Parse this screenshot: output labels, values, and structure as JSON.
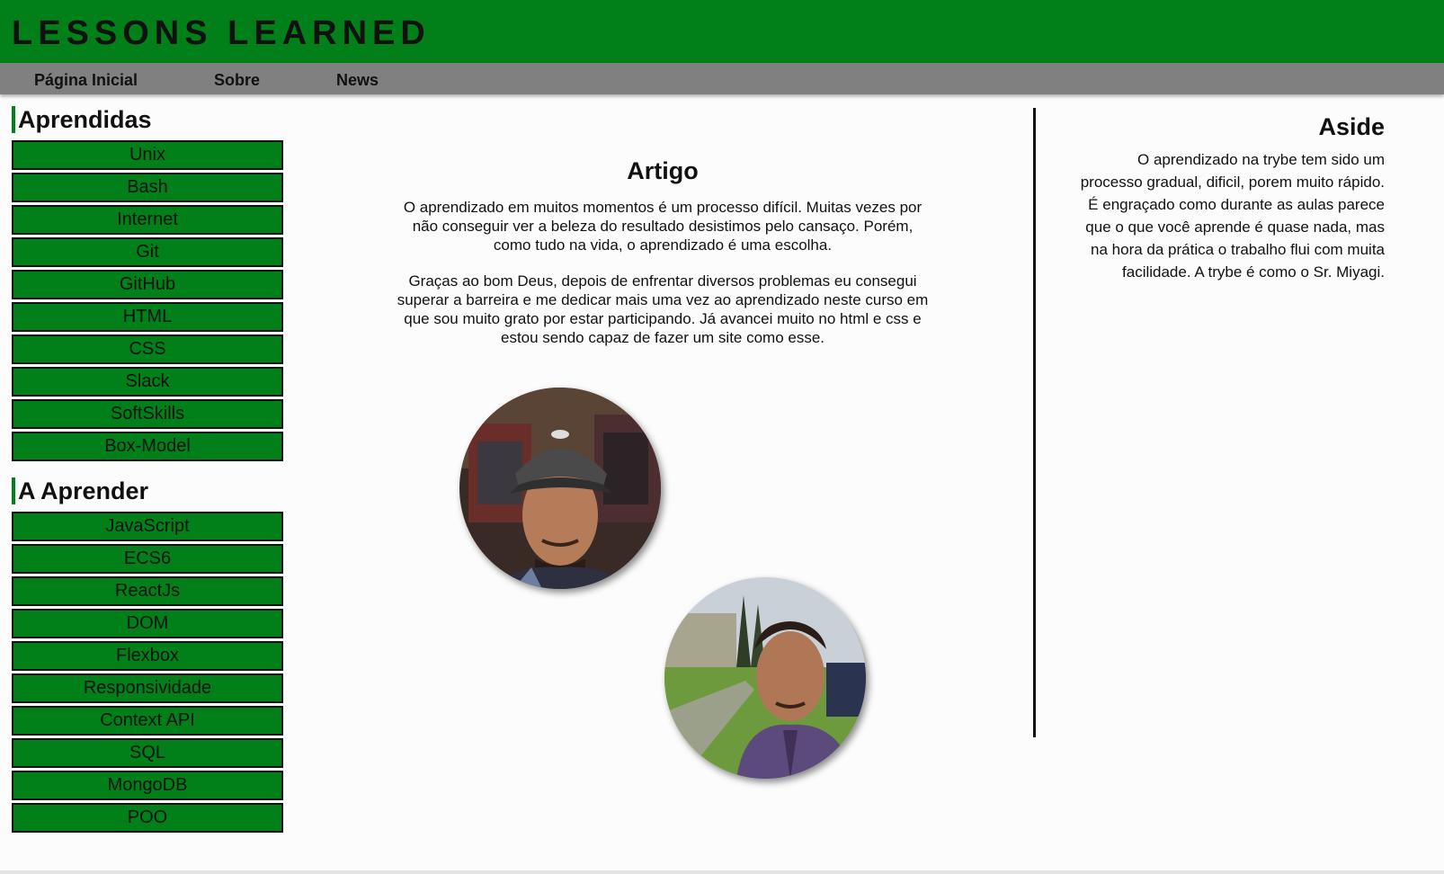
{
  "header": {
    "title": "LESSONS LEARNED"
  },
  "nav": {
    "items": [
      "Página Inicial",
      "Sobre",
      "News"
    ]
  },
  "sidebar": {
    "learned_heading": "Aprendidas",
    "learned": [
      "Unix",
      "Bash",
      "Internet",
      "Git",
      "GitHub",
      "HTML",
      "CSS",
      "Slack",
      "SoftSkills",
      "Box-Model"
    ],
    "to_learn_heading": "A Aprender",
    "to_learn": [
      "JavaScript",
      "ECS6",
      "ReactJs",
      "DOM",
      "Flexbox",
      "Responsividade",
      "Context API",
      "SQL",
      "MongoDB",
      "POO"
    ]
  },
  "article": {
    "title": "Artigo",
    "paragraphs": [
      "O aprendizado em muitos momentos é um processo difícil. Muitas vezes por não conseguir ver a beleza do resultado desistimos pelo cansaço. Porém, como tudo na vida, o aprendizado é uma escolha.",
      "Graças ao bom Deus, depois de enfrentar diversos problemas eu consegui superar a barreira e me dedicar mais uma vez ao aprendizado neste curso em que sou muito grato por estar participando. Já avancei muito no html e css e estou sendo capaz de fazer um site como esse."
    ]
  },
  "aside": {
    "title": "Aside",
    "text": "O aprendizado na trybe tem sido um processo gradual, dificil, porem muito rápido. É engraçado como durante as aulas parece que o que você aprende é quase nada, mas na hora da prática o trabalho flui com muita facilidade. A trybe é como o Sr. Miyagi."
  },
  "colors": {
    "brand_green": "#018019",
    "nav_gray": "#808080"
  }
}
